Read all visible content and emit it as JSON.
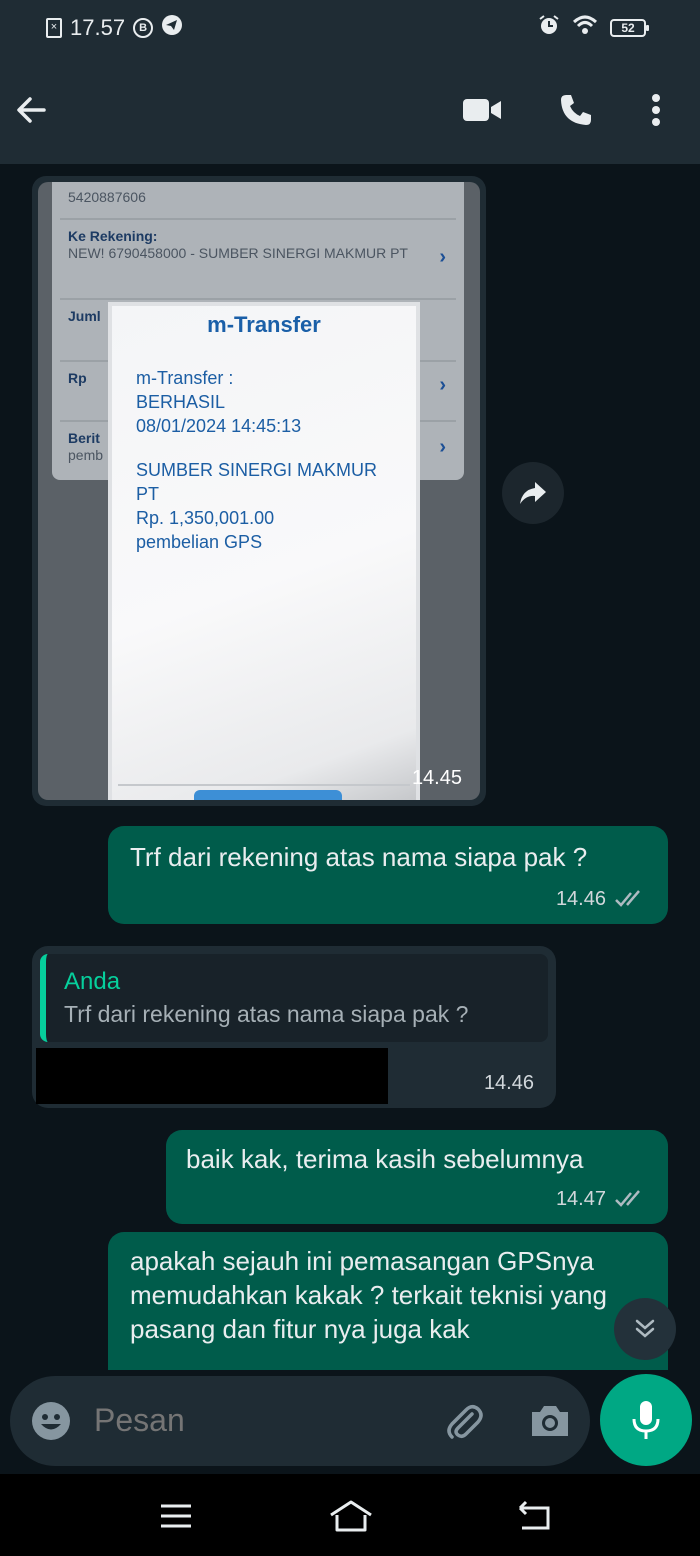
{
  "status_bar": {
    "time": "17.57",
    "battery": "52"
  },
  "app_bar": {
    "icons": [
      "back-arrow-icon",
      "video-call-icon",
      "voice-call-icon",
      "more-options-icon"
    ]
  },
  "image_message": {
    "receipt_background": {
      "account_number": "5420887606",
      "to_account_label": "Ke Rekening:",
      "to_account_value": "NEW! 6790458000 - SUMBER SINERGI MAKMUR PT",
      "amount_label_partial": "Juml",
      "currency_label": "Rp",
      "news_label_partial": "Berit",
      "news_value_partial": "pemb"
    },
    "popup": {
      "title": "m-Transfer",
      "line1": "m-Transfer :",
      "line2": "BERHASIL",
      "line3": "08/01/2024 14:45:13",
      "line4": "SUMBER SINERGI MAKMUR",
      "line5": "PT",
      "line6": "Rp. 1,350,001.00",
      "line7": "pembelian GPS"
    },
    "time": "14.45"
  },
  "messages": {
    "m1": {
      "text": "Trf dari rekening atas nama siapa pak ?",
      "time": "14.46"
    },
    "m2": {
      "quote_author": "Anda",
      "quote_text": "Trf dari rekening atas nama siapa pak ?",
      "time": "14.46"
    },
    "m3": {
      "text": "baik kak, terima kasih sebelumnya",
      "time": "14.47"
    },
    "m4": {
      "text": "apakah sejauh ini pemasangan GPSnya memudahkan kakak ? terkait teknisi yang pasang dan fitur nya juga kak"
    }
  },
  "input": {
    "placeholder": "Pesan"
  },
  "colors": {
    "background": "#0b141a",
    "header": "#1f2c34",
    "incoming_bubble": "#1f2c34",
    "outgoing_bubble": "#005c4b",
    "accent": "#00a884",
    "quote_accent": "#06cf9c"
  }
}
